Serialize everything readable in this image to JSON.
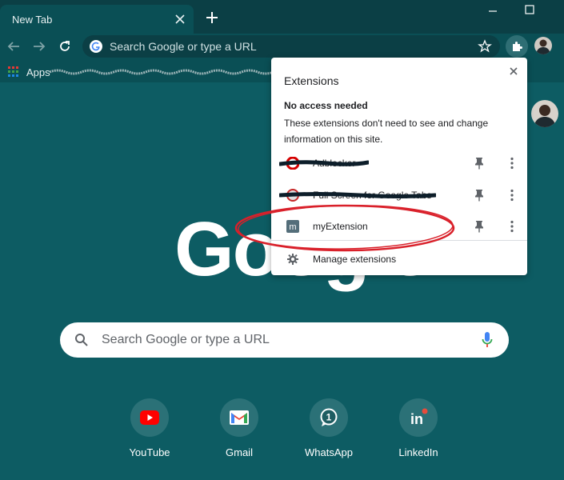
{
  "tab": {
    "title": "New Tab"
  },
  "omnibox": {
    "placeholder": "Search Google or type a URL"
  },
  "bookmarks": {
    "apps_label": "Apps"
  },
  "ntp": {
    "logo_text": "Google",
    "search_placeholder": "Search Google or type a URL",
    "shortcuts": [
      {
        "label": "YouTube",
        "icon": "youtube-icon"
      },
      {
        "label": "Gmail",
        "icon": "gmail-icon"
      },
      {
        "label": "WhatsApp",
        "icon": "whatsapp-icon"
      },
      {
        "label": "LinkedIn",
        "icon": "linkedin-icon"
      }
    ]
  },
  "extensions_popup": {
    "title": "Extensions",
    "section_title": "No access needed",
    "section_desc": "These extensions don't need to see and change information on this site.",
    "items": [
      {
        "name": "Adblocker",
        "redacted": true
      },
      {
        "name": "Full Screen for Google Tabs",
        "redacted": true
      },
      {
        "name": "myExtension",
        "redacted": false,
        "icon_letter": "m"
      }
    ],
    "manage_label": "Manage extensions"
  },
  "colors": {
    "theme_background": "#0d5c63",
    "frame": "#0b3f45",
    "toolbar": "#0a4f55",
    "annotation_red": "#d9202a"
  }
}
